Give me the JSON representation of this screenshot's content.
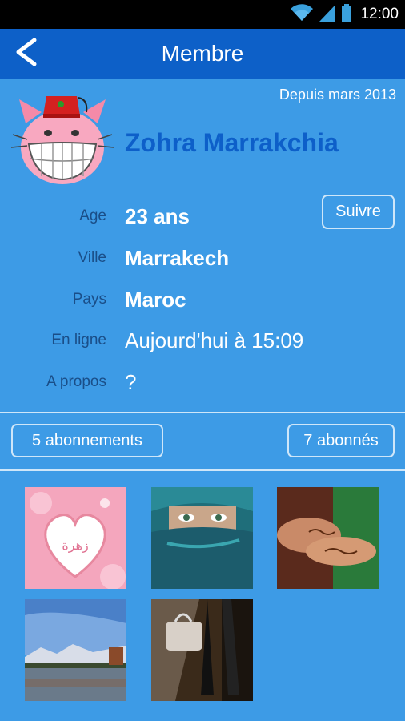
{
  "status_bar": {
    "time": "12:00"
  },
  "app_bar": {
    "title": "Membre"
  },
  "profile": {
    "since": "Depuis mars 2013",
    "name": "Zohra Marrakchia",
    "follow_label": "Suivre"
  },
  "info": [
    {
      "label": "Age",
      "value": "23 ans"
    },
    {
      "label": "Ville",
      "value": "Marrakech"
    },
    {
      "label": "Pays",
      "value": "Maroc"
    },
    {
      "label": "En ligne",
      "value": "Aujourd'hui à 15:09"
    },
    {
      "label": "A propos",
      "value": "?"
    }
  ],
  "counts": {
    "subscriptions": "5 abonnements",
    "subscribers": "7 abonnés"
  },
  "photos": {
    "heart_text": "زهرة"
  },
  "colors": {
    "app_bar": "#0d60c8",
    "background": "#3d9be6",
    "name": "#0d5fc9",
    "label": "#1a4e88"
  }
}
